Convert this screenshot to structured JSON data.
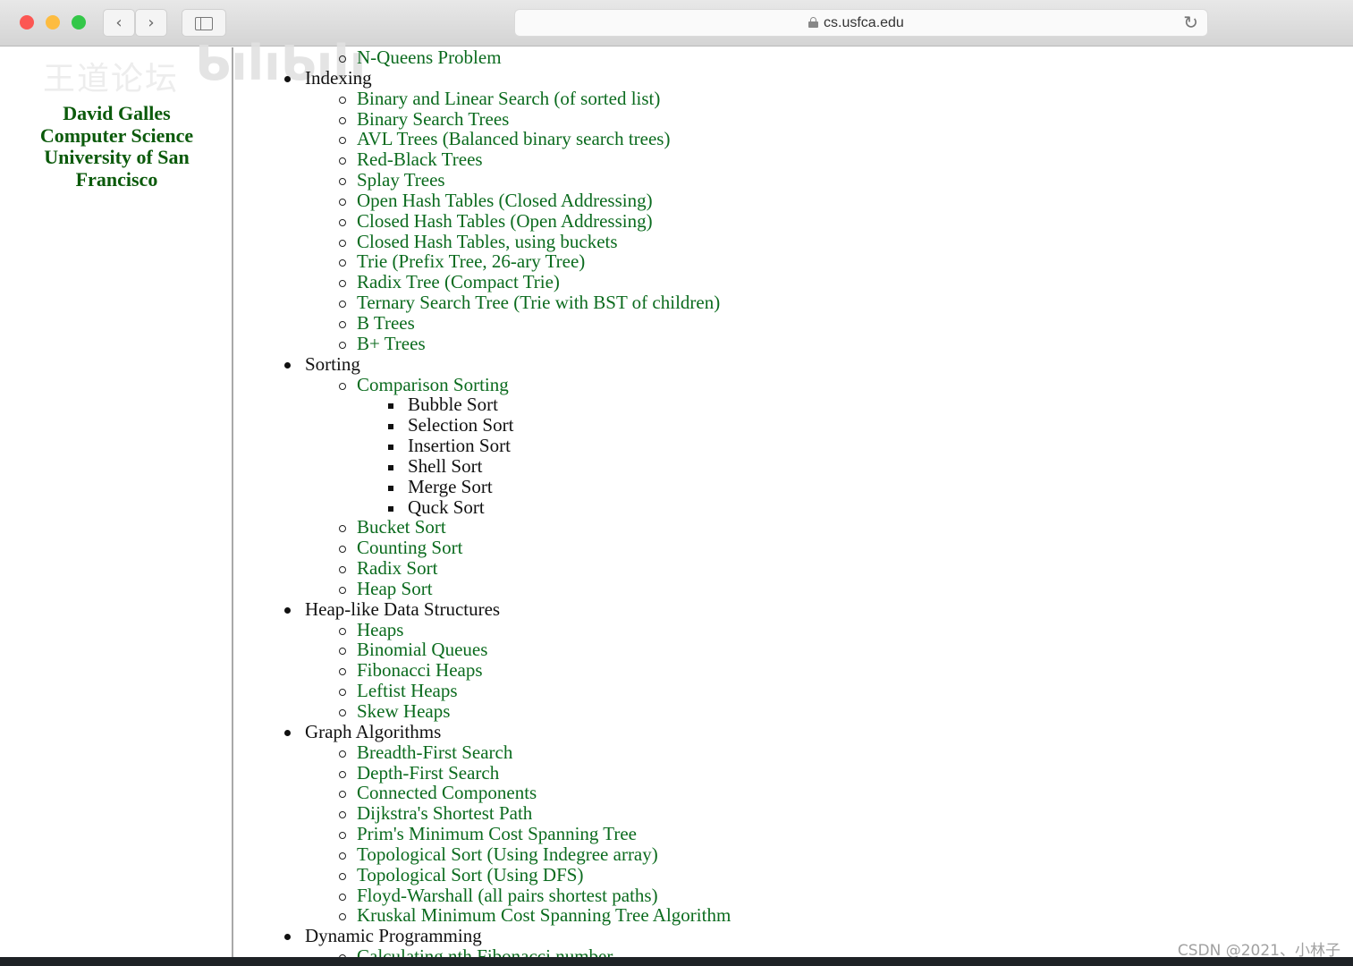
{
  "browser": {
    "url": "cs.usfca.edu",
    "colors": {
      "close": "#fc5753",
      "minimize": "#fdbc40",
      "maximize": "#33c748"
    },
    "icons": [
      "lock-icon",
      "back-icon",
      "forward-icon",
      "sidebar-icon",
      "reload-icon"
    ],
    "back": "‹",
    "forward": "›",
    "reload": "↻"
  },
  "sidebar": {
    "author": [
      "David Galles",
      "Computer Science",
      "University of San",
      "Francisco"
    ]
  },
  "watermark": {
    "text": "王道论坛",
    "logo": "bilibili",
    "credit": "CSDN @2021、小林子"
  },
  "colors": {
    "link": "#0b6b1e",
    "author": "#0b5a0b"
  },
  "content": {
    "top_partial": [
      "N-Queens Problem"
    ],
    "categories": [
      {
        "label": "Indexing",
        "items": [
          "Binary and Linear Search (of sorted list)",
          "Binary Search Trees",
          "AVL Trees (Balanced binary search trees)",
          "Red-Black Trees",
          "Splay Trees",
          "Open Hash Tables (Closed Addressing)",
          "Closed Hash Tables (Open Addressing)",
          "Closed Hash Tables, using buckets",
          "Trie (Prefix Tree, 26-ary Tree)",
          "Radix Tree (Compact Trie)",
          "Ternary Search Tree (Trie with BST of children)",
          "B Trees",
          "B+ Trees"
        ]
      },
      {
        "label": "Sorting",
        "comparison": {
          "label": "Comparison Sorting",
          "items": [
            "Bubble Sort",
            "Selection Sort",
            "Insertion Sort",
            "Shell Sort",
            "Merge Sort",
            "Quck Sort"
          ]
        },
        "items": [
          "Bucket Sort",
          "Counting Sort",
          "Radix Sort",
          "Heap Sort"
        ]
      },
      {
        "label": "Heap-like Data Structures",
        "items": [
          "Heaps",
          "Binomial Queues",
          "Fibonacci Heaps",
          "Leftist Heaps",
          "Skew Heaps"
        ]
      },
      {
        "label": "Graph Algorithms",
        "items": [
          "Breadth-First Search",
          "Depth-First Search",
          "Connected Components",
          "Dijkstra's Shortest Path",
          "Prim's Minimum Cost Spanning Tree",
          "Topological Sort (Using Indegree array)",
          "Topological Sort (Using DFS)",
          "Floyd-Warshall (all pairs shortest paths)",
          "Kruskal Minimum Cost Spanning Tree Algorithm"
        ]
      },
      {
        "label": "Dynamic Programming",
        "items": [
          "Calculating nth Fibonacci number"
        ]
      }
    ]
  }
}
